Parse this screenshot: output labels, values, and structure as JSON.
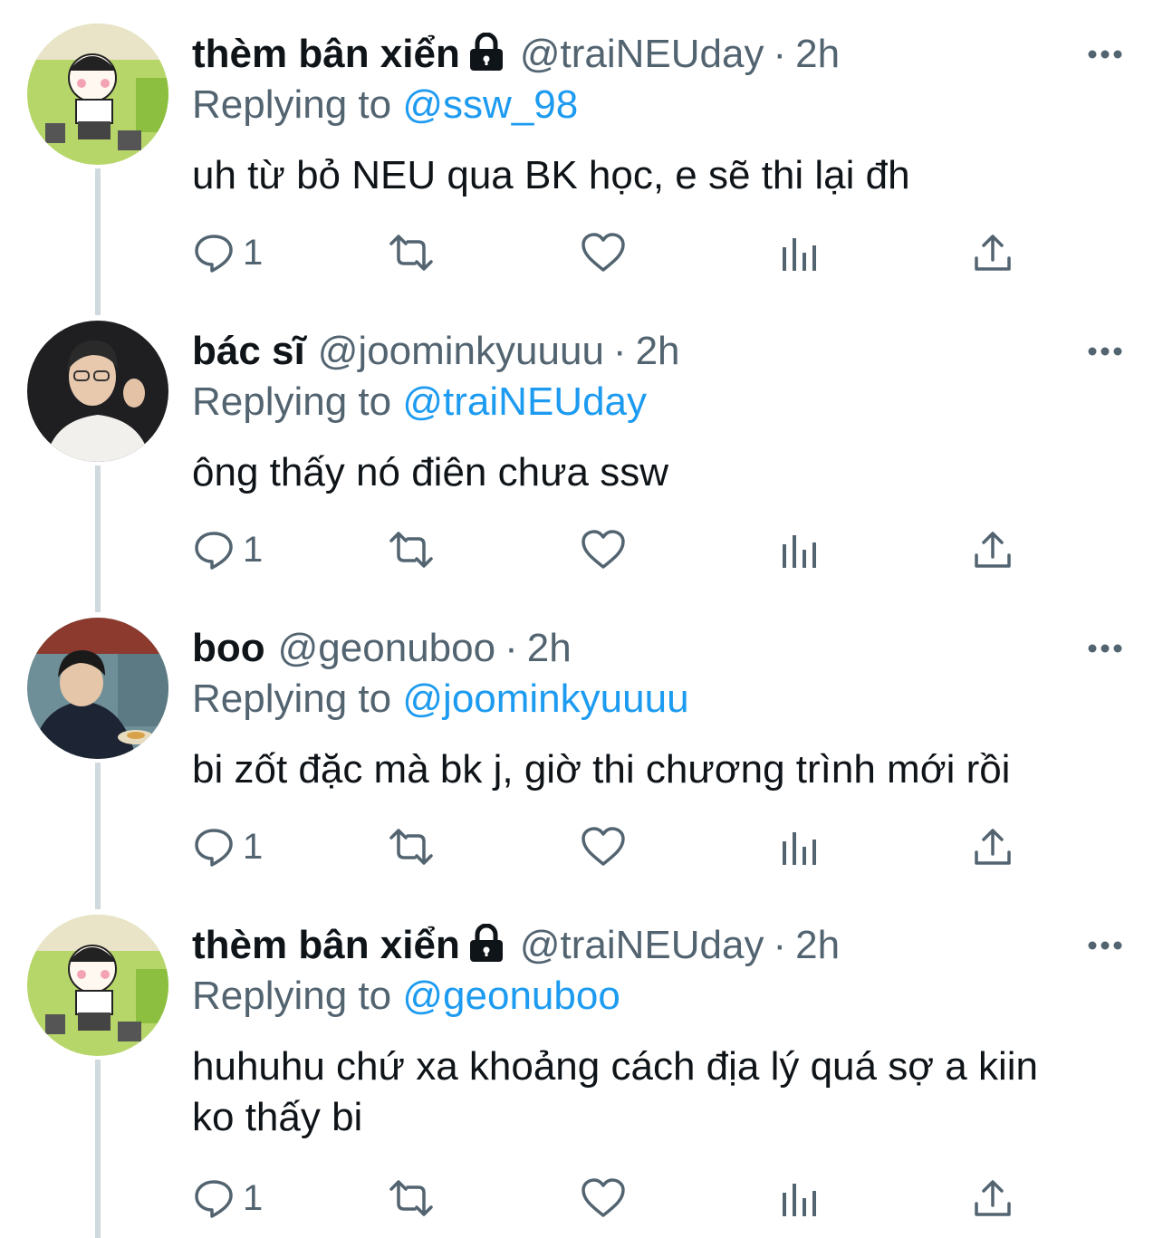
{
  "colors": {
    "text": "#0f1419",
    "muted": "#536471",
    "accent": "#1d9bf0",
    "thread": "#cfd9de"
  },
  "tweets": [
    {
      "name": "thèm bân xiển",
      "locked": true,
      "handle": "@traiNEUday",
      "dot": "·",
      "time": "2h",
      "reply_prefix": "Replying to",
      "reply_mention": "@ssw_98",
      "text": "uh từ bỏ NEU qua BK học, e sẽ thi lại đh",
      "reply_count": "1",
      "avatar": "cartoon-boy-avatar"
    },
    {
      "name": "bác sĩ",
      "locked": false,
      "handle": "@joominkyuuuu",
      "dot": "·",
      "time": "2h",
      "reply_prefix": "Replying to",
      "reply_mention": "@traiNEUday",
      "text": "ông thấy nó điên chưa ssw",
      "reply_count": "1",
      "avatar": "man-photo-avatar"
    },
    {
      "name": "boo",
      "locked": false,
      "handle": "@geonuboo",
      "dot": "·",
      "time": "2h",
      "reply_prefix": "Replying to",
      "reply_mention": "@joominkyuuuu",
      "text": "bi zốt đặc mà bk j, giờ thi chương trình mới rồi",
      "reply_count": "1",
      "avatar": "eating-photo-avatar"
    },
    {
      "name": "thèm bân xiển",
      "locked": true,
      "handle": "@traiNEUday",
      "dot": "·",
      "time": "2h",
      "reply_prefix": "Replying to",
      "reply_mention": "@geonuboo",
      "text": "huhuhu chứ xa khoảng cách địa lý quá sợ a kiin ko thấy bi",
      "reply_count": "1",
      "avatar": "cartoon-boy-avatar"
    }
  ]
}
